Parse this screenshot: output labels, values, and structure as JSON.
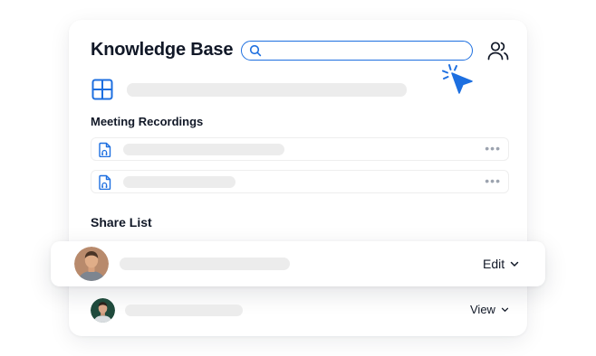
{
  "header": {
    "title": "Knowledge Base",
    "search": {
      "value": "",
      "placeholder": ""
    }
  },
  "sections": {
    "meeting_recordings": "Meeting Recordings",
    "share_list": "Share List"
  },
  "recordings": [
    {
      "menu": "•••"
    },
    {
      "menu": "•••"
    }
  ],
  "share": [
    {
      "permission": "Edit",
      "highlighted": true
    },
    {
      "permission": "View",
      "highlighted": false
    }
  ],
  "icons": {
    "search": "search-icon",
    "users": "users-icon",
    "grid": "grid-icon",
    "file_audio": "audio-file-icon",
    "cursor": "click-cursor-icon",
    "chevron": "chevron-down-icon"
  },
  "colors": {
    "accent": "#1d6fe0",
    "skeleton": "#ececec",
    "text": "#111827"
  }
}
